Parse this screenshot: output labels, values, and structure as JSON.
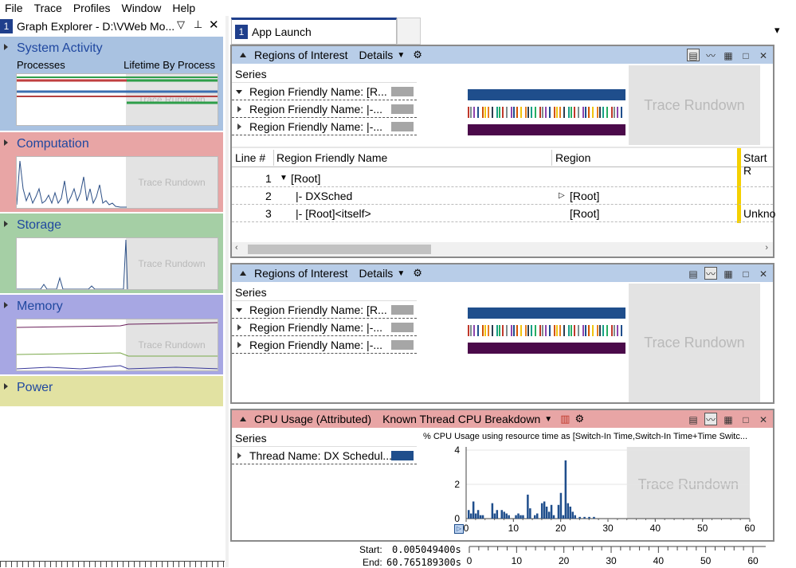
{
  "menu": [
    "File",
    "Trace",
    "Profiles",
    "Window",
    "Help"
  ],
  "graph_explorer": {
    "badge": "1",
    "title": "Graph Explorer - D:\\VWeb Mo...",
    "categories": [
      {
        "name": "System Activity",
        "sub_left": "Processes",
        "sub_right": "Lifetime By Process",
        "rundown": "Trace Rundown",
        "color": "#a9c2e1"
      },
      {
        "name": "Computation",
        "rundown": "Trace Rundown",
        "color": "#e8a5a5"
      },
      {
        "name": "Storage",
        "rundown": "Trace Rundown",
        "color": "#a5cfa5"
      },
      {
        "name": "Memory",
        "rundown": "Trace Rundown",
        "color": "#a7a7e3"
      },
      {
        "name": "Power",
        "color": "#e2e2a2"
      }
    ]
  },
  "tab": {
    "badge": "1",
    "label": "App Launch"
  },
  "panel1": {
    "title": "Regions of Interest",
    "details": "Details",
    "series_header": "Series",
    "series": [
      "Region Friendly Name: [R...",
      "Region Friendly Name:  |-...",
      "Region Friendly Name:  |-..."
    ],
    "rundown": "Trace Rundown",
    "table": {
      "headers": [
        "Line #",
        "Region Friendly Name",
        "Region",
        "Start R"
      ],
      "rows": [
        {
          "line": "1",
          "name": "[Root]",
          "region": "",
          "start": ""
        },
        {
          "line": "2",
          "name": "|- DXSched",
          "region": "[Root]",
          "start": ""
        },
        {
          "line": "3",
          "name": "|- [Root]<itself>",
          "region": "[Root]",
          "start": "Unkno"
        }
      ]
    }
  },
  "panel2": {
    "title": "Regions of Interest",
    "details": "Details",
    "series_header": "Series",
    "series": [
      "Region Friendly Name: [R...",
      "Region Friendly Name:  |-...",
      "Region Friendly Name:  |-..."
    ],
    "rundown": "Trace Rundown"
  },
  "panel3": {
    "title": "CPU Usage (Attributed)",
    "preset": "Known Thread CPU Breakdown",
    "series_header": "Series",
    "series": [
      "Thread Name: DX Schedul..."
    ],
    "chart_title": "% CPU Usage using resource time as [Switch-In Time,Switch-In Time+Time Switc...",
    "rundown": "Trace Rundown",
    "swatch_color": "#1f4e8c"
  },
  "timeline": {
    "start_label": "Start:",
    "start": "0.005049400s",
    "end_label": "End:",
    "end": "60.765189300s"
  },
  "chart_data": {
    "type": "bar",
    "title": "% CPU Usage using resource time as [Switch-In Time,Switch-In Time+Time Switc...",
    "xlim": [
      0,
      60
    ],
    "ylim": [
      0,
      4
    ],
    "xticks": [
      0,
      10,
      20,
      30,
      40,
      50,
      60
    ],
    "yticks": [
      0,
      2,
      4
    ],
    "rundown_start": 34,
    "series": [
      {
        "values_x": [
          0.5,
          1,
          1.5,
          2,
          2.5,
          3,
          3.5,
          5.5,
          6,
          6.5,
          7.5,
          8,
          8.5,
          9,
          10.5,
          11,
          11.5,
          12,
          13,
          13.5,
          14.5,
          15,
          16,
          16.5,
          17,
          17.5,
          18,
          18.5,
          19.5,
          20,
          20.5,
          21,
          21.5,
          22,
          22.5,
          23,
          24,
          25,
          26,
          27
        ],
        "values_y": [
          0.5,
          0.3,
          1.0,
          0.3,
          0.5,
          0.2,
          0.2,
          0.9,
          0.3,
          0.5,
          0.5,
          0.4,
          0.3,
          0.2,
          0.2,
          0.3,
          0.2,
          0.2,
          1.4,
          0.6,
          0.2,
          0.3,
          0.9,
          1.0,
          0.7,
          0.4,
          0.8,
          0.2,
          0.8,
          1.5,
          0.2,
          3.4,
          0.9,
          0.7,
          0.4,
          0.2,
          0.1,
          0.1,
          0.1,
          0.1
        ]
      }
    ]
  }
}
